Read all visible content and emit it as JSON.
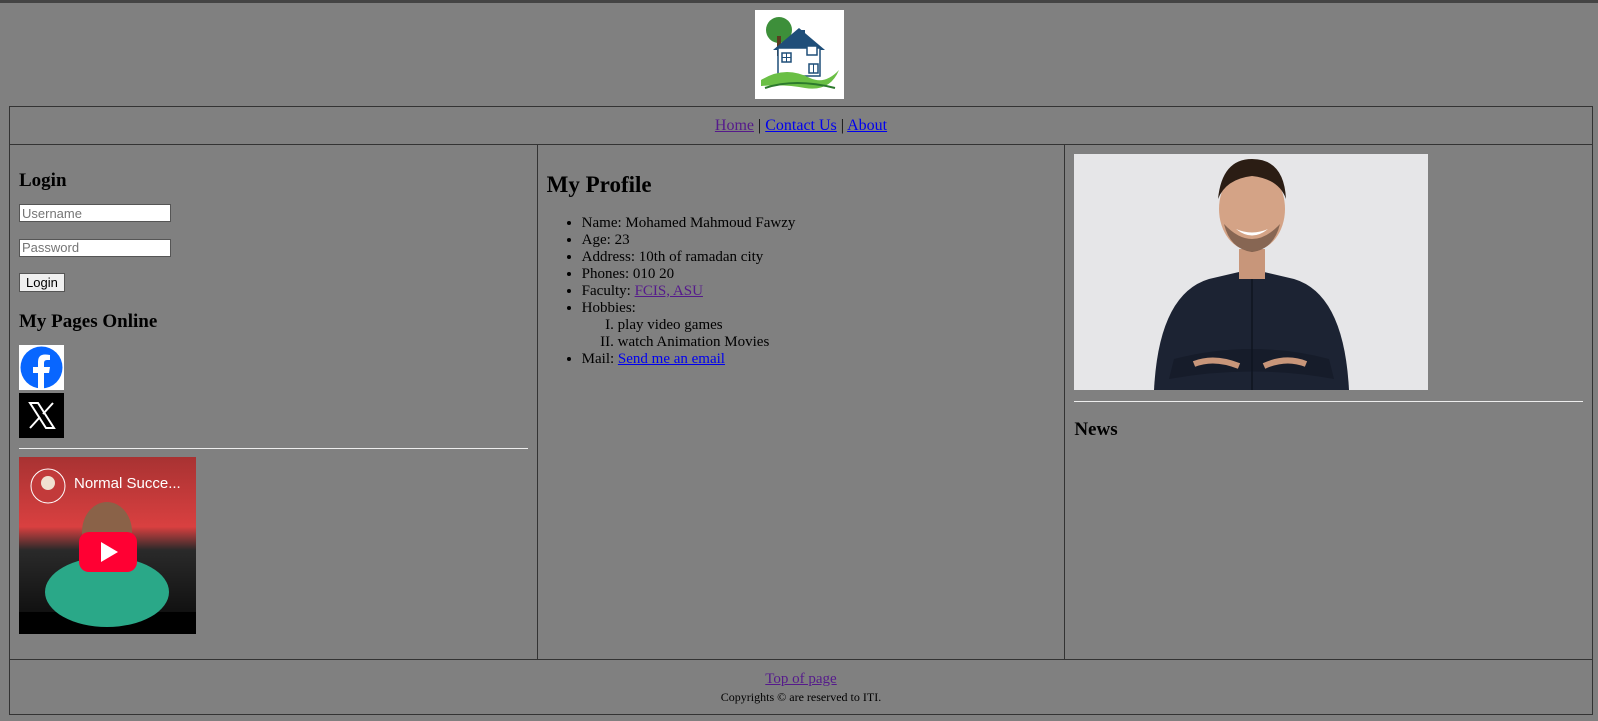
{
  "nav": {
    "home": "Home",
    "sep1": "|",
    "contact": "Contact Us",
    "sep2": "|",
    "about": "About"
  },
  "left": {
    "login_heading": "Login",
    "username_placeholder": "Username",
    "password_placeholder": "Password",
    "login_button": "Login",
    "pages_heading": "My Pages Online",
    "video_title": "Normal Succe..."
  },
  "main": {
    "heading": "My Profile",
    "name_label": "Name: ",
    "name_value": "Mohamed Mahmoud Fawzy",
    "age_label": "Age: ",
    "age_value": "23",
    "address_label": "Address: ",
    "address_value": "10th of ramadan city",
    "phones_label": "Phones: ",
    "phones_value": "010 20",
    "faculty_label": "Faculty: ",
    "faculty_link": "FCIS, ASU",
    "hobbies_label": "Hobbies:",
    "hobbies": [
      "play video games",
      "watch Animation Movies"
    ],
    "mail_label": "Mail: ",
    "mail_link": "Send me an email"
  },
  "right": {
    "news_heading": "News"
  },
  "footer": {
    "top_link": "Top of page",
    "copyright": "Copyrights © are reserved to ITI."
  }
}
